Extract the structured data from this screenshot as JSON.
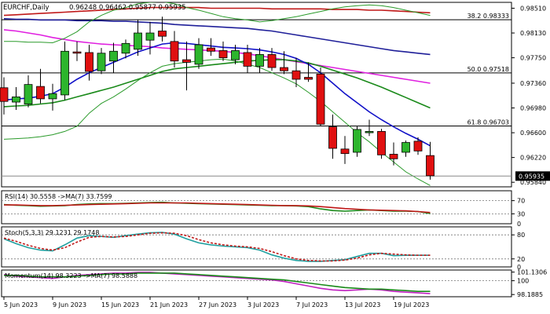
{
  "chart_data": {
    "type": "candlestick",
    "header": {
      "symbol_timeframe": "EURCHF,Daily",
      "ohlc": "0.96248 0.96462 0.95877 0.95935"
    },
    "x_labels": [
      "5 Jun 2023",
      "9 Jun 2023",
      "15 Jun 2023",
      "21 Jun 2023",
      "27 Jun 2023",
      "3 Jul 2023",
      "7 Jul 2023",
      "13 Jul 2023",
      "19 Jul 2023"
    ],
    "x_label_index": [
      0,
      4,
      8,
      12,
      16,
      20,
      24,
      28,
      32
    ],
    "y_ticks": [
      "0.98510",
      "0.98130",
      "0.97750",
      "0.97360",
      "0.96980",
      "0.96600",
      "0.96220",
      "0.95840"
    ],
    "y_tick_values": [
      0.9851,
      0.9813,
      0.9775,
      0.9736,
      0.9698,
      0.966,
      0.9622,
      0.9584
    ],
    "ylim": [
      0.9577,
      0.986
    ],
    "last_price": "0.95935",
    "last_price_value": 0.95935,
    "fib_levels": [
      {
        "label": "38.2 0.98333",
        "value": 0.98333
      },
      {
        "label": "50.0 0.97518",
        "value": 0.97518
      },
      {
        "label": "61.8 0.96703",
        "value": 0.96703
      }
    ],
    "candles": [
      {
        "o": 0.9729,
        "h": 0.9745,
        "l": 0.9688,
        "c": 0.9708
      },
      {
        "o": 0.9707,
        "h": 0.973,
        "l": 0.9695,
        "c": 0.9715
      },
      {
        "o": 0.9704,
        "h": 0.9748,
        "l": 0.9699,
        "c": 0.9734
      },
      {
        "o": 0.9731,
        "h": 0.9758,
        "l": 0.9705,
        "c": 0.9712
      },
      {
        "o": 0.9712,
        "h": 0.9735,
        "l": 0.9694,
        "c": 0.972
      },
      {
        "o": 0.9718,
        "h": 0.98,
        "l": 0.971,
        "c": 0.9785
      },
      {
        "o": 0.9784,
        "h": 0.98,
        "l": 0.977,
        "c": 0.9782
      },
      {
        "o": 0.9783,
        "h": 0.9795,
        "l": 0.974,
        "c": 0.9754
      },
      {
        "o": 0.9755,
        "h": 0.979,
        "l": 0.975,
        "c": 0.9782
      },
      {
        "o": 0.977,
        "h": 0.9798,
        "l": 0.9752,
        "c": 0.9785
      },
      {
        "o": 0.9782,
        "h": 0.9803,
        "l": 0.9774,
        "c": 0.9797
      },
      {
        "o": 0.9788,
        "h": 0.9833,
        "l": 0.9778,
        "c": 0.9813
      },
      {
        "o": 0.9802,
        "h": 0.983,
        "l": 0.978,
        "c": 0.9813
      },
      {
        "o": 0.9816,
        "h": 0.9838,
        "l": 0.98,
        "c": 0.9808
      },
      {
        "o": 0.98,
        "h": 0.9816,
        "l": 0.976,
        "c": 0.977
      },
      {
        "o": 0.9772,
        "h": 0.98,
        "l": 0.9725,
        "c": 0.9768
      },
      {
        "o": 0.9765,
        "h": 0.9805,
        "l": 0.9758,
        "c": 0.9795
      },
      {
        "o": 0.979,
        "h": 0.9805,
        "l": 0.9778,
        "c": 0.9785
      },
      {
        "o": 0.9786,
        "h": 0.98,
        "l": 0.977,
        "c": 0.9775
      },
      {
        "o": 0.9772,
        "h": 0.9795,
        "l": 0.9765,
        "c": 0.9786
      },
      {
        "o": 0.9783,
        "h": 0.9795,
        "l": 0.9752,
        "c": 0.9762
      },
      {
        "o": 0.9762,
        "h": 0.979,
        "l": 0.9752,
        "c": 0.978
      },
      {
        "o": 0.978,
        "h": 0.979,
        "l": 0.9755,
        "c": 0.976
      },
      {
        "o": 0.976,
        "h": 0.9785,
        "l": 0.975,
        "c": 0.9755
      },
      {
        "o": 0.9755,
        "h": 0.9775,
        "l": 0.973,
        "c": 0.9742
      },
      {
        "o": 0.9745,
        "h": 0.9768,
        "l": 0.9738,
        "c": 0.9742
      },
      {
        "o": 0.975,
        "h": 0.976,
        "l": 0.967,
        "c": 0.9673
      },
      {
        "o": 0.9669,
        "h": 0.9688,
        "l": 0.962,
        "c": 0.9636
      },
      {
        "o": 0.9635,
        "h": 0.9655,
        "l": 0.9612,
        "c": 0.9628
      },
      {
        "o": 0.963,
        "h": 0.967,
        "l": 0.9623,
        "c": 0.9665
      },
      {
        "o": 0.966,
        "h": 0.968,
        "l": 0.9655,
        "c": 0.9662
      },
      {
        "o": 0.9662,
        "h": 0.9666,
        "l": 0.962,
        "c": 0.9626
      },
      {
        "o": 0.9627,
        "h": 0.9645,
        "l": 0.961,
        "c": 0.962
      },
      {
        "o": 0.963,
        "h": 0.9648,
        "l": 0.9623,
        "c": 0.9645
      },
      {
        "o": 0.9647,
        "h": 0.9653,
        "l": 0.9626,
        "c": 0.9632
      },
      {
        "o": 0.9625,
        "h": 0.9646,
        "l": 0.9588,
        "c": 0.9594
      }
    ],
    "overlay_lines": [
      {
        "color": "#1f1f99",
        "values": [
          0.9835,
          0.9834,
          0.9834,
          0.9833,
          0.9833,
          0.9833,
          0.9832,
          0.9832,
          0.9832,
          0.9831,
          0.9831,
          0.983,
          0.9829,
          0.9828,
          0.9826,
          0.9825,
          0.9824,
          0.9823,
          0.9822,
          0.9821,
          0.982,
          0.9818,
          0.9816,
          0.9813,
          0.981,
          0.9807,
          0.9804,
          0.9801,
          0.9798,
          0.9795,
          0.9792,
          0.9789,
          0.9786,
          0.9784,
          0.9782,
          0.978
        ]
      },
      {
        "color": "#e020e0",
        "values": [
          0.9818,
          0.9816,
          0.9813,
          0.981,
          0.9806,
          0.9803,
          0.98,
          0.9798,
          0.9796,
          0.9795,
          0.9794,
          0.9793,
          0.9792,
          0.979,
          0.9789,
          0.9788,
          0.9787,
          0.9786,
          0.9785,
          0.9783,
          0.9781,
          0.9778,
          0.9775,
          0.9772,
          0.9769,
          0.9766,
          0.9763,
          0.976,
          0.9757,
          0.9754,
          0.9751,
          0.9748,
          0.9745,
          0.9742,
          0.9739,
          0.9736
        ]
      },
      {
        "color": "#c01818",
        "values": [
          0.984,
          0.9841,
          0.9842,
          0.9843,
          0.9844,
          0.9845,
          0.9846,
          0.9847,
          0.9848,
          0.9849,
          0.985,
          0.9851,
          0.9852,
          0.9852,
          0.9852,
          0.9852,
          0.9852,
          0.9851,
          0.9851,
          0.9851,
          0.9851,
          0.9851,
          0.985,
          0.985,
          0.985,
          0.985,
          0.985,
          0.9849,
          0.9849,
          0.9849,
          0.9848,
          0.9848,
          0.9847,
          0.9846,
          0.9845,
          0.9844
        ]
      },
      {
        "color": "#1a8a1a",
        "values": [
          0.97,
          0.9701,
          0.9702,
          0.9704,
          0.9706,
          0.971,
          0.9715,
          0.972,
          0.9725,
          0.973,
          0.9736,
          0.9742,
          0.9748,
          0.9754,
          0.9758,
          0.976,
          0.9762,
          0.9764,
          0.9766,
          0.9768,
          0.977,
          0.9771,
          0.9772,
          0.9772,
          0.977,
          0.9767,
          0.9762,
          0.9756,
          0.975,
          0.9744,
          0.9737,
          0.973,
          0.9722,
          0.9714,
          0.9706,
          0.9698
        ]
      },
      {
        "color": "#1010c8",
        "values": [
          0.971,
          0.9712,
          0.9713,
          0.9716,
          0.972,
          0.973,
          0.9742,
          0.9752,
          0.976,
          0.9768,
          0.9776,
          0.9784,
          0.979,
          0.9796,
          0.9798,
          0.9797,
          0.9795,
          0.9793,
          0.9791,
          0.979,
          0.9789,
          0.9787,
          0.9784,
          0.978,
          0.9774,
          0.9765,
          0.9752,
          0.9736,
          0.972,
          0.9706,
          0.9692,
          0.968,
          0.9669,
          0.9659,
          0.965,
          0.964
        ]
      },
      {
        "color": "#2a9a2a",
        "values": [
          0.965,
          0.9651,
          0.9652,
          0.9654,
          0.9657,
          0.9662,
          0.967,
          0.969,
          0.9705,
          0.9715,
          0.9727,
          0.974,
          0.9752,
          0.9762,
          0.9766,
          0.9768,
          0.977,
          0.9772,
          0.9773,
          0.977,
          0.9765,
          0.976,
          0.9752,
          0.9744,
          0.9735,
          0.9722,
          0.9708,
          0.9692,
          0.9676,
          0.966,
          0.9646,
          0.963,
          0.9615,
          0.96,
          0.9589,
          0.9579
        ]
      },
      {
        "color": "#2a9a2a",
        "values": [
          0.98,
          0.98,
          0.9799,
          0.9799,
          0.9798,
          0.9805,
          0.9815,
          0.983,
          0.984,
          0.9848,
          0.9852,
          0.9858,
          0.986,
          0.9861,
          0.9858,
          0.9852,
          0.9848,
          0.9843,
          0.9838,
          0.9835,
          0.9833,
          0.983,
          0.9832,
          0.9835,
          0.9838,
          0.9842,
          0.9846,
          0.985,
          0.9853,
          0.9855,
          0.9856,
          0.9855,
          0.9852,
          0.9848,
          0.9844,
          0.984
        ]
      }
    ],
    "subpanels": [
      {
        "label": "RSI(14) 30.5558 ->MA(7) 33.7599",
        "ticks": [
          "70",
          "30"
        ],
        "tick_values": [
          70,
          30
        ],
        "extra_ticks": [
          "0"
        ],
        "extra_tick_values": [
          0
        ],
        "ylim": [
          0,
          100
        ],
        "levels": [
          70,
          30
        ],
        "lines": [
          {
            "color": "#1a8a1a",
            "values": [
              58,
              56,
              55,
              53,
              54,
              55,
              58,
              60,
              61,
              61,
              62,
              63,
              64,
              65,
              63,
              62,
              61,
              60,
              59,
              58,
              57,
              56,
              55,
              55,
              54,
              52,
              45,
              40,
              38,
              40,
              42,
              40,
              38,
              38,
              37,
              31
            ]
          },
          {
            "color": "#c01818",
            "values": [
              57,
              57,
              56,
              55,
              55,
              56,
              57,
              58,
              59,
              60,
              61,
              62,
              63,
              63,
              63,
              63,
              62,
              61,
              60,
              59,
              58,
              57,
              56,
              55,
              55,
              54,
              52,
              49,
              46,
              44,
              42,
              41,
              40,
              39,
              37,
              34
            ]
          }
        ]
      },
      {
        "label": "Stoch(5,3,3) 29.1231 29.1748",
        "ticks": [
          "80",
          "20"
        ],
        "tick_values": [
          80,
          20
        ],
        "extra_ticks": [
          "0"
        ],
        "extra_tick_values": [
          0
        ],
        "ylim": [
          0,
          100
        ],
        "levels": [
          80,
          20
        ],
        "lines": [
          {
            "color": "#20a0a0",
            "values": [
              70,
              58,
              48,
              42,
              40,
              55,
              72,
              78,
              76,
              74,
              78,
              82,
              85,
              86,
              82,
              70,
              60,
              55,
              52,
              50,
              48,
              42,
              30,
              22,
              16,
              14,
              14,
              16,
              18,
              26,
              34,
              34,
              28,
              29,
              29,
              29
            ]
          },
          {
            "color": "#c01818",
            "values": [
              72,
              64,
              54,
              46,
              42,
              48,
              62,
              74,
              76,
              75,
              76,
              80,
              84,
              85,
              84,
              78,
              68,
              60,
              55,
              52,
              50,
              46,
              38,
              28,
              20,
              16,
              15,
              15,
              17,
              22,
              30,
              34,
              32,
              30,
              29,
              29
            ]
          }
        ]
      },
      {
        "label": "Momentum(14) 98.3223 ->MA(7) 98.5888",
        "ticks": [
          "101.1306",
          "100",
          "98.1885"
        ],
        "tick_values": [
          101.1306,
          100,
          98.1885
        ],
        "ylim": [
          97.9,
          101.4
        ],
        "levels": [
          100
        ],
        "lines": [
          {
            "color": "#c020c0",
            "values": [
              100.8,
              100.6,
              100.5,
              100.4,
              100.3,
              100.5,
              100.7,
              100.8,
              100.9,
              101.0,
              101.0,
              101.1,
              101.1,
              101.0,
              100.9,
              100.8,
              100.7,
              100.6,
              100.5,
              100.4,
              100.3,
              100.2,
              100.1,
              99.9,
              99.6,
              99.3,
              99.0,
              98.8,
              98.7,
              98.8,
              98.9,
              98.8,
              98.6,
              98.5,
              98.4,
              98.3
            ]
          },
          {
            "color": "#1a8a1a",
            "values": [
              100.7,
              100.7,
              100.6,
              100.5,
              100.5,
              100.5,
              100.6,
              100.7,
              100.8,
              100.9,
              100.9,
              101.0,
              101.0,
              101.0,
              101.0,
              100.9,
              100.8,
              100.7,
              100.6,
              100.5,
              100.4,
              100.3,
              100.2,
              100.1,
              99.9,
              99.7,
              99.5,
              99.3,
              99.1,
              99.0,
              98.9,
              98.9,
              98.8,
              98.7,
              98.6,
              98.6
            ]
          }
        ]
      }
    ],
    "colors": {
      "bull": "#2db52d",
      "bear": "#e01010",
      "fib": "#000000",
      "axis": "#000000"
    }
  }
}
